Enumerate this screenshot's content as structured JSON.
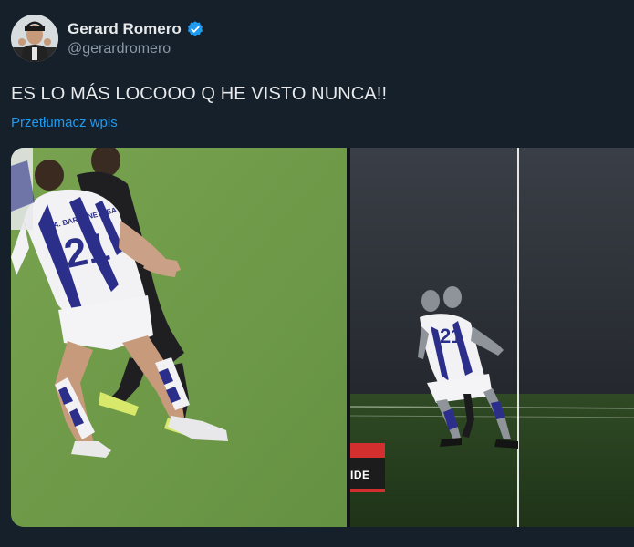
{
  "author": {
    "display_name": "Gerard Romero",
    "handle": "@gerardromero",
    "verified": true,
    "avatar_icon": "avatar-photo"
  },
  "tweet": {
    "text": "ES LO MÁS LOCOOO Q HE VISTO NUNCA!!",
    "translate_label": "Przetłumacz wpis"
  },
  "media": {
    "left_image": {
      "jersey_number": "21",
      "jersey_name": "A. BARRENETXEA"
    },
    "right_image": {
      "jersey_number": "21",
      "graphic_label": "IDE"
    }
  },
  "colors": {
    "background": "#15202b",
    "accent": "#1d9bf0",
    "verified": "#1d9bf0",
    "pitch": "#6e9a48",
    "var_red": "#d32f2f"
  }
}
